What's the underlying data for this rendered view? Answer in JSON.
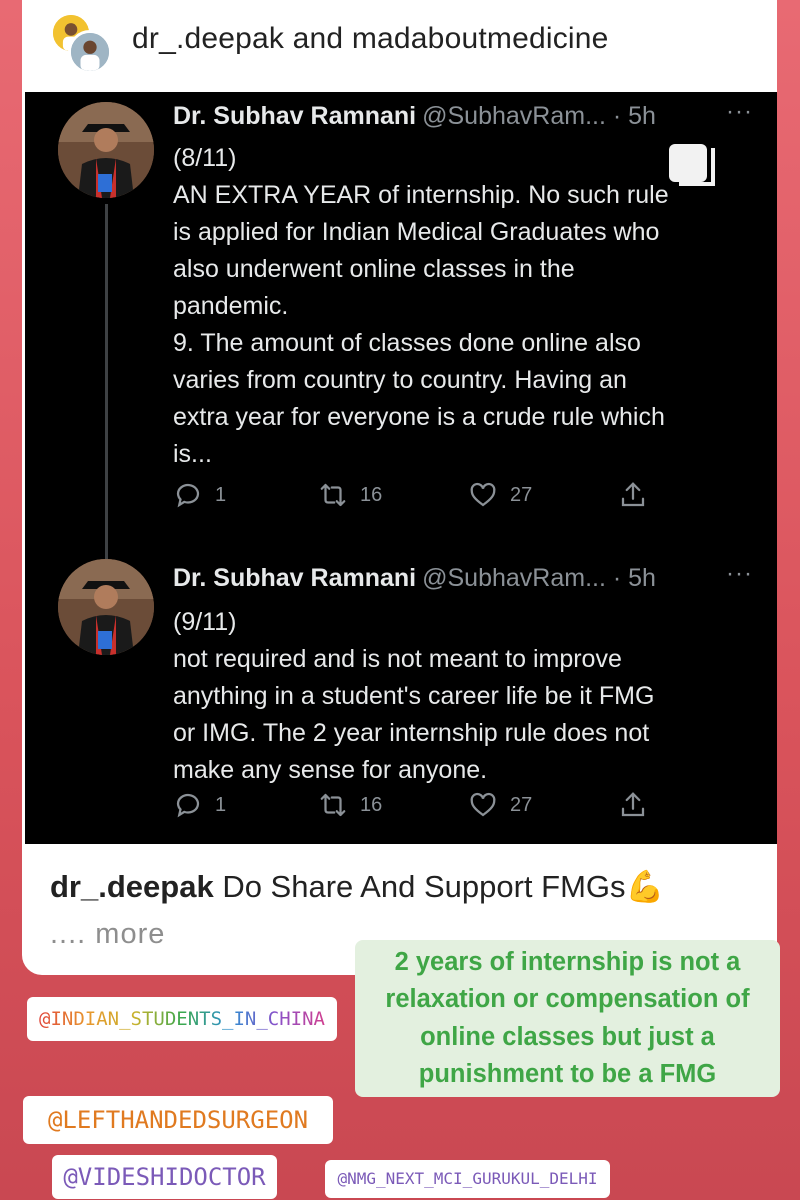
{
  "post": {
    "accounts_title": "dr_.deepak and madaboutmedicine"
  },
  "tweets": [
    {
      "author_name": "Dr. Subhav Ramnani",
      "handle_time": "@SubhavRam... · 5h",
      "more": "···",
      "body": "(8/11)\nAN EXTRA YEAR of internship. No such rule\nis applied for Indian Medical Graduates who\nalso underwent online classes in the\npandemic.\n9. The amount of classes done online also\nvaries from country to country. Having an\nextra year for everyone is a crude rule which\nis...",
      "replies": "1",
      "retweets": "16",
      "likes": "27"
    },
    {
      "author_name": "Dr. Subhav Ramnani",
      "handle_time": "@SubhavRam... · 5h",
      "more": "···",
      "body": "(9/11)\nnot required and is not meant to improve\nanything in a student's career life be it FMG\nor IMG. The 2 year internship rule does not\nmake any sense for anyone.",
      "replies": "1",
      "retweets": "16",
      "likes": "27"
    }
  ],
  "caption": {
    "username": "dr_.deepak",
    "text": " Do Share And Support FMGs💪",
    "more": ".... more"
  },
  "stickers": {
    "note": "2 years of internship is not a relaxation or compensation of online classes but just a punishment to be a FMG",
    "tag_china": "@INDIAN_STUDENTS_IN_CHINA",
    "tag_lefthanded": "@LEFTHANDEDSURGEON",
    "tag_videshi": "@VIDESHIDOCTOR",
    "tag_nmg": "@NMG_NEXT_MCI_GURUKUL_DELHI"
  },
  "colors": {
    "background": "#d9535b",
    "tweet_bg": "#000000",
    "note_text": "#3fa646",
    "note_bg": "#e3f0df"
  }
}
